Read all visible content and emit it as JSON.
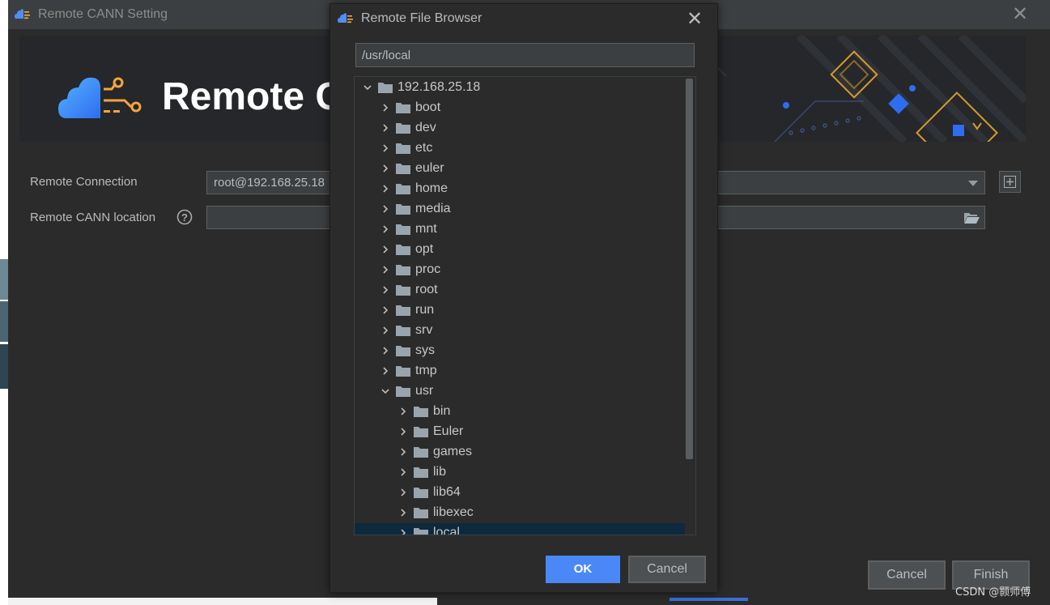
{
  "main_dialog": {
    "title": "Remote CANN Setting",
    "banner_title": "Remote C",
    "remote_connection_label": "Remote Connection",
    "remote_connection_value": "root@192.168.25.18",
    "cann_location_label": "Remote CANN location",
    "cann_location_value": "",
    "cancel_label": "Cancel",
    "finish_label": "Finish"
  },
  "file_browser": {
    "title": "Remote File Browser",
    "path": "/usr/local",
    "ok_label": "OK",
    "cancel_label": "Cancel",
    "tree": [
      {
        "label": "192.168.25.18",
        "expanded": true,
        "level": 0
      },
      {
        "label": "boot",
        "expanded": false,
        "level": 1
      },
      {
        "label": "dev",
        "expanded": false,
        "level": 1
      },
      {
        "label": "etc",
        "expanded": false,
        "level": 1
      },
      {
        "label": "euler",
        "expanded": false,
        "level": 1
      },
      {
        "label": "home",
        "expanded": false,
        "level": 1
      },
      {
        "label": "media",
        "expanded": false,
        "level": 1
      },
      {
        "label": "mnt",
        "expanded": false,
        "level": 1
      },
      {
        "label": "opt",
        "expanded": false,
        "level": 1
      },
      {
        "label": "proc",
        "expanded": false,
        "level": 1
      },
      {
        "label": "root",
        "expanded": false,
        "level": 1
      },
      {
        "label": "run",
        "expanded": false,
        "level": 1
      },
      {
        "label": "srv",
        "expanded": false,
        "level": 1
      },
      {
        "label": "sys",
        "expanded": false,
        "level": 1
      },
      {
        "label": "tmp",
        "expanded": false,
        "level": 1
      },
      {
        "label": "usr",
        "expanded": true,
        "level": 1
      },
      {
        "label": "bin",
        "expanded": false,
        "level": 2
      },
      {
        "label": "Euler",
        "expanded": false,
        "level": 2
      },
      {
        "label": "games",
        "expanded": false,
        "level": 2
      },
      {
        "label": "lib",
        "expanded": false,
        "level": 2
      },
      {
        "label": "lib64",
        "expanded": false,
        "level": 2
      },
      {
        "label": "libexec",
        "expanded": false,
        "level": 2
      },
      {
        "label": "local",
        "expanded": false,
        "level": 2,
        "selected": true
      }
    ]
  },
  "watermark": "CSDN @颢师傅",
  "icons": {
    "app": "cann-cloud-icon",
    "folder": "folder-icon",
    "help": "help-icon",
    "add": "add-icon",
    "dropdown": "chevron-down-icon",
    "browse": "folder-open-icon",
    "close": "close-icon"
  },
  "colors": {
    "dialog_bg": "#2b2b2b",
    "titlebar_bg": "#3c3f41",
    "accent_blue": "#4a88f7",
    "selection": "#0d293e",
    "logo_blue": "#3f8ef7",
    "logo_orange": "#f7a53b"
  }
}
